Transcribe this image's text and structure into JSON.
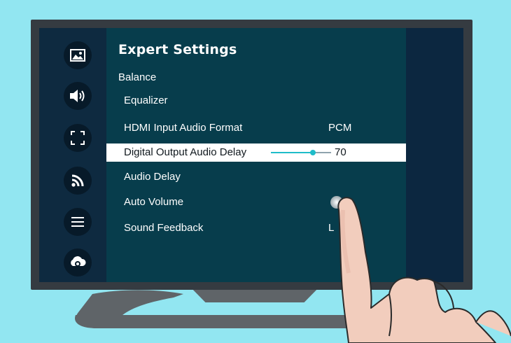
{
  "page": {
    "title": "Expert Settings",
    "section": "Balance"
  },
  "sidebar": {
    "items": [
      {
        "icon": "picture-icon"
      },
      {
        "icon": "speaker-icon"
      },
      {
        "icon": "fullscreen-icon"
      },
      {
        "icon": "wireless-icon"
      },
      {
        "icon": "menu-icon"
      },
      {
        "icon": "support-icon"
      }
    ]
  },
  "menu": {
    "items": [
      {
        "label": "Equalizer",
        "value": ""
      },
      {
        "label": "HDMI Input Audio Format",
        "value": "PCM"
      },
      {
        "label": "Digital Output Audio Delay",
        "value": "70",
        "slider_fraction": 0.7,
        "selected": true
      },
      {
        "label": "Audio Delay",
        "value": ""
      },
      {
        "label": "Auto Volume",
        "value": ""
      },
      {
        "label": "Sound Feedback",
        "value": "L"
      }
    ]
  },
  "colors": {
    "background": "#92e6f1",
    "panel": "#073d4c",
    "sidebar": "#0e2a40",
    "accent": "#1fbcc9",
    "selected_row": "#ffffff"
  }
}
